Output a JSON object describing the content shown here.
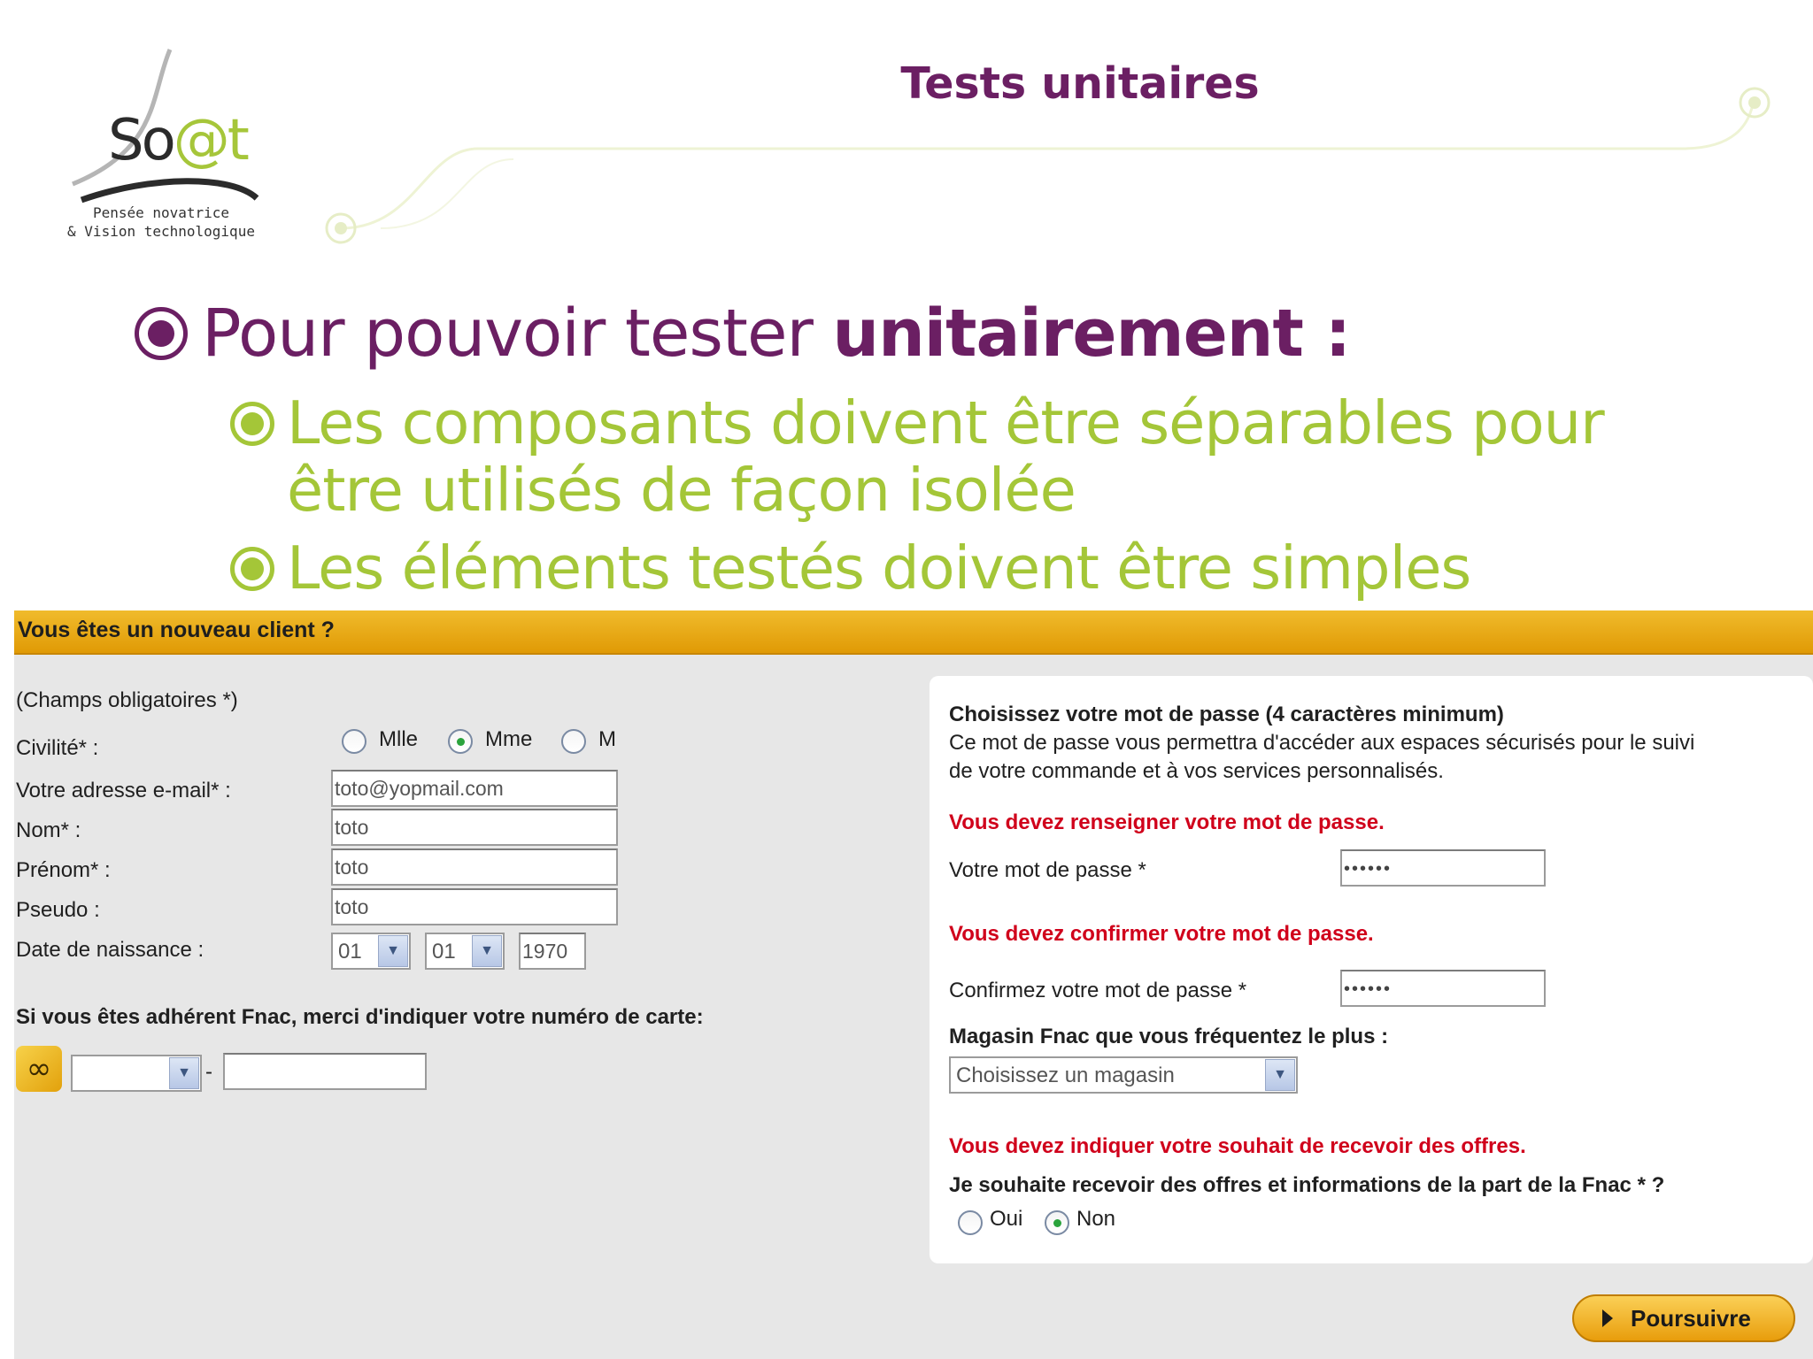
{
  "slide": {
    "title": "Tests unitaires",
    "logo": {
      "prefix": "So",
      "at": "@t",
      "tagline": "Pensée novatrice\n& Vision technologique"
    },
    "bullets": {
      "main_prefix": "Pour pouvoir tester ",
      "main_bold": "unitairement :",
      "sub": [
        "Les composants doivent être séparables pour être utilisés de façon isolée",
        "Les éléments testés doivent être simples"
      ]
    },
    "colors": {
      "title": "#6b1f63",
      "sub_bullets": "#a4c638"
    }
  },
  "form": {
    "header": "Vous êtes un nouveau client ?",
    "required_note": "(Champs obligatoires *)",
    "civilite": {
      "label": "Civilité* :",
      "options": [
        "Mlle",
        "Mme",
        "M"
      ],
      "selected": "Mme"
    },
    "email": {
      "label": "Votre adresse e-mail* :",
      "value": "toto@yopmail.com"
    },
    "nom": {
      "label": "Nom* :",
      "value": "toto"
    },
    "prenom": {
      "label": "Prénom* :",
      "value": "toto"
    },
    "pseudo": {
      "label": "Pseudo :",
      "value": "toto"
    },
    "birth": {
      "label": "Date de naissance :",
      "day": "01",
      "month": "01",
      "year": "1970"
    },
    "fnac_card": {
      "label": "Si vous êtes adhérent Fnac, merci d'indiquer votre numéro de carte:",
      "prefix_value": "",
      "separator": "-",
      "number_value": ""
    },
    "password_panel": {
      "title": "Choisissez votre mot de passe (4 caractères minimum)",
      "desc_line1": "Ce mot de passe vous permettra d'accéder aux espaces sécurisés pour le suivi",
      "desc_line2": "de votre commande et à vos services personnalisés.",
      "error_password": "Vous devez renseigner votre mot de passe.",
      "password_label": "Votre mot de passe *",
      "password_value": "••••••",
      "error_confirm": "Vous devez confirmer votre mot de passe.",
      "confirm_label": "Confirmez votre mot de passe *",
      "confirm_value": "••••••",
      "store_label": "Magasin Fnac que vous fréquentez le plus :",
      "store_value": "Choisissez un magasin",
      "error_offers": "Vous devez indiquer votre souhait de recevoir des offres.",
      "offers_label": "Je souhaite recevoir des offres et informations de la part de la Fnac * ?",
      "offers_options": [
        "Oui",
        "Non"
      ],
      "offers_selected": "Non"
    },
    "submit_label": "Poursuivre",
    "colors": {
      "bar": "#e6a30f",
      "error": "#d0001b",
      "background": "#e7e7e7"
    }
  }
}
